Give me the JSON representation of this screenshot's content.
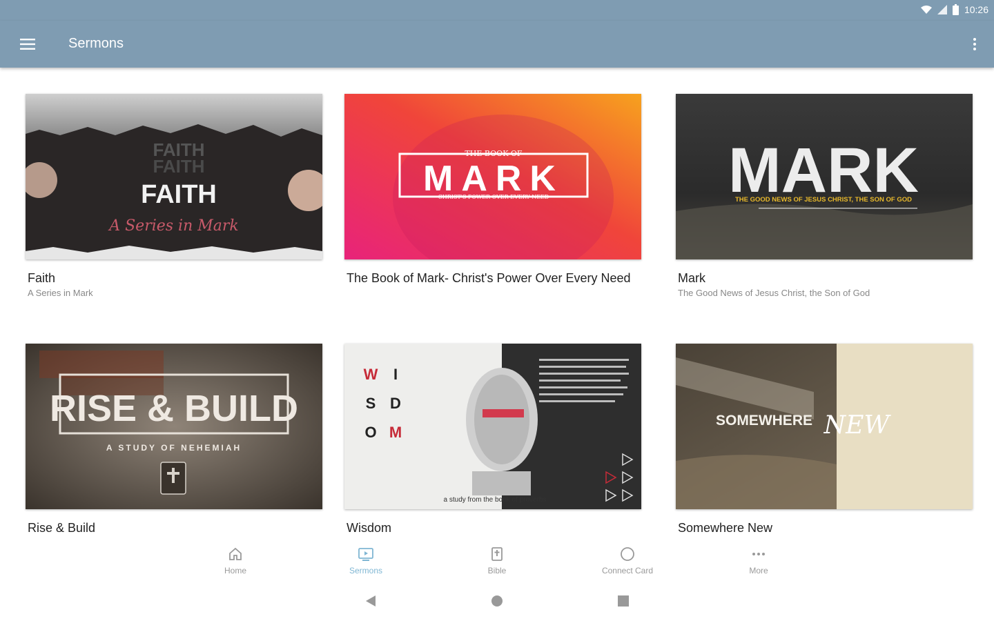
{
  "status": {
    "time": "10:26"
  },
  "app_bar": {
    "title": "Sermons"
  },
  "cards": [
    {
      "title": "Faith",
      "subtitle": "A Series in Mark",
      "art": {
        "main": "FAITH",
        "script": "A Series in Mark"
      }
    },
    {
      "title": "The Book of Mark- Christ's Power Over Every Need",
      "subtitle": "",
      "art": {
        "top": "THE BOOK OF",
        "main": "MARK",
        "bottom": "CHRIST'S POWER OVER EVERY NEED"
      }
    },
    {
      "title": "Mark",
      "subtitle": "The Good News of Jesus Christ, the Son of God",
      "art": {
        "main": "MARK",
        "bottom": "THE GOOD NEWS OF JESUS CHRIST, THE SON OF GOD"
      }
    },
    {
      "title": "Rise & Build",
      "subtitle": "",
      "art": {
        "main": "RISE & BUILD",
        "bottom": "A STUDY OF NEHEMIAH"
      }
    },
    {
      "title": "Wisdom",
      "subtitle": "",
      "art": {
        "letters": [
          "W",
          "I",
          "S",
          "D",
          "O",
          "M"
        ],
        "bottom": "a study from the book of proverbs"
      }
    },
    {
      "title": "Somewhere New",
      "subtitle": "",
      "art": {
        "main": "SOMEWHERE",
        "script": "NEW"
      }
    }
  ],
  "nav": [
    {
      "label": "Home",
      "icon": "home-icon"
    },
    {
      "label": "Sermons",
      "icon": "sermons-icon",
      "active": true
    },
    {
      "label": "Bible",
      "icon": "bible-icon"
    },
    {
      "label": "Connect Card",
      "icon": "connect-card-icon"
    },
    {
      "label": "More",
      "icon": "more-icon"
    }
  ],
  "colors": {
    "app_bar": "#7f9cb2",
    "active_nav": "#7fb6d3"
  }
}
